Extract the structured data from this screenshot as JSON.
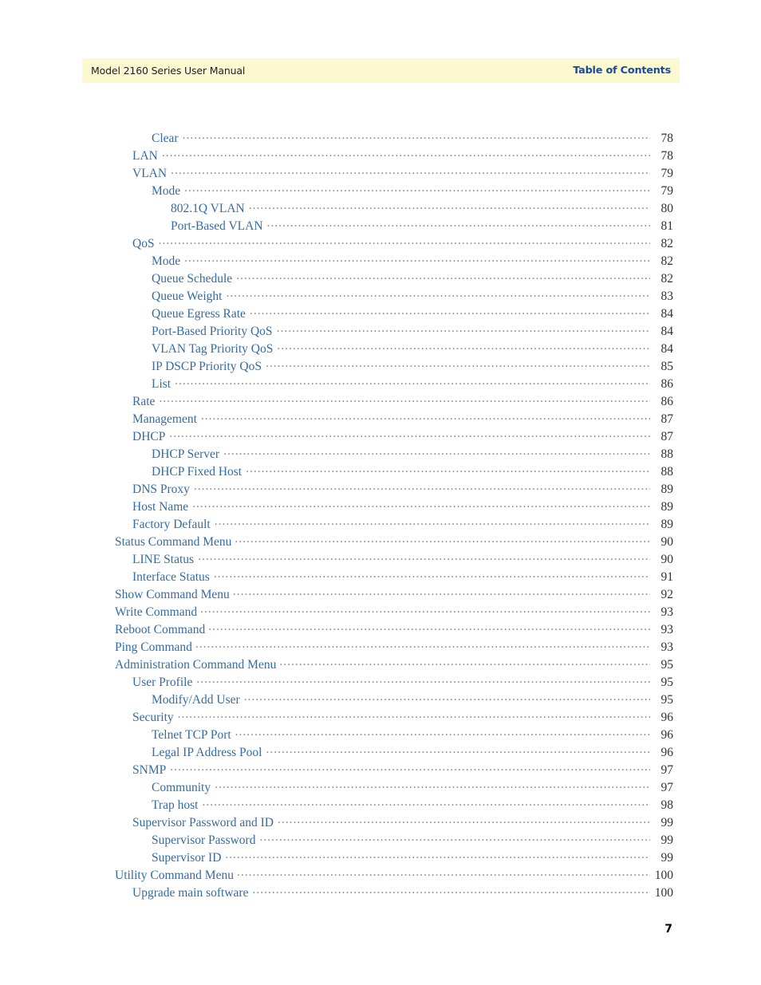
{
  "header": {
    "left_title": "Model 2160 Series User Manual",
    "right_title": "Table of Contents",
    "band_color": "#fcf8cf",
    "right_title_color": "#1a4a9c"
  },
  "footer": {
    "page_number": "7"
  },
  "toc": {
    "link_color": "#356ba5",
    "leader_color": "#8c8c8c",
    "entries": [
      {
        "label": "Clear",
        "page": "78",
        "level": 1
      },
      {
        "label": "LAN",
        "page": "78",
        "level": 0
      },
      {
        "label": "VLAN",
        "page": "79",
        "level": 0
      },
      {
        "label": "Mode",
        "page": "79",
        "level": 1
      },
      {
        "label": "802.1Q VLAN",
        "page": "80",
        "level": 2
      },
      {
        "label": "Port-Based VLAN",
        "page": "81",
        "level": 2
      },
      {
        "label": "QoS",
        "page": "82",
        "level": 0
      },
      {
        "label": "Mode",
        "page": "82",
        "level": 1
      },
      {
        "label": "Queue Schedule",
        "page": "82",
        "level": 1
      },
      {
        "label": "Queue Weight",
        "page": "83",
        "level": 1
      },
      {
        "label": "Queue Egress Rate",
        "page": "84",
        "level": 1
      },
      {
        "label": "Port-Based Priority QoS",
        "page": "84",
        "level": 1
      },
      {
        "label": "VLAN Tag Priority QoS",
        "page": "84",
        "level": 1
      },
      {
        "label": "IP DSCP Priority QoS",
        "page": "85",
        "level": 1
      },
      {
        "label": "List",
        "page": "86",
        "level": 1
      },
      {
        "label": "Rate",
        "page": "86",
        "level": 0
      },
      {
        "label": "Management",
        "page": "87",
        "level": 0
      },
      {
        "label": "DHCP",
        "page": "87",
        "level": 0
      },
      {
        "label": "DHCP Server",
        "page": "88",
        "level": 1
      },
      {
        "label": "DHCP Fixed Host",
        "page": "88",
        "level": 1
      },
      {
        "label": "DNS Proxy",
        "page": "89",
        "level": 0
      },
      {
        "label": "Host Name",
        "page": "89",
        "level": 0
      },
      {
        "label": "Factory Default",
        "page": "89",
        "level": 0
      },
      {
        "label": "Status Command Menu",
        "page": "90",
        "level": -1
      },
      {
        "label": "LINE Status",
        "page": "90",
        "level": 0
      },
      {
        "label": "Interface Status",
        "page": "91",
        "level": 0
      },
      {
        "label": "Show Command Menu",
        "page": "92",
        "level": -1
      },
      {
        "label": "Write Command",
        "page": "93",
        "level": -1
      },
      {
        "label": "Reboot Command",
        "page": "93",
        "level": -1
      },
      {
        "label": "Ping Command",
        "page": "93",
        "level": -1
      },
      {
        "label": "Administration Command Menu",
        "page": "95",
        "level": -1
      },
      {
        "label": "User Profile",
        "page": "95",
        "level": 0
      },
      {
        "label": "Modify/Add User",
        "page": "95",
        "level": 1
      },
      {
        "label": "Security",
        "page": "96",
        "level": 0
      },
      {
        "label": "Telnet TCP Port",
        "page": "96",
        "level": 1
      },
      {
        "label": "Legal IP Address Pool",
        "page": "96",
        "level": 1
      },
      {
        "label": "SNMP",
        "page": "97",
        "level": 0
      },
      {
        "label": "Community",
        "page": "97",
        "level": 1
      },
      {
        "label": "Trap host",
        "page": "98",
        "level": 1
      },
      {
        "label": "Supervisor Password and ID",
        "page": "99",
        "level": 0
      },
      {
        "label": "Supervisor Password",
        "page": "99",
        "level": 1
      },
      {
        "label": "Supervisor ID",
        "page": "99",
        "level": 1
      },
      {
        "label": "Utility Command Menu",
        "page": "100",
        "level": -1
      },
      {
        "label": "Upgrade main software",
        "page": "100",
        "level": 0
      }
    ]
  }
}
